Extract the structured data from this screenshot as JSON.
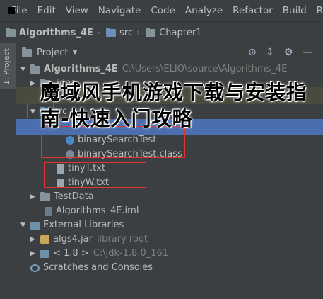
{
  "menu": {
    "items": [
      "File",
      "Edit",
      "View",
      "Navigate",
      "Code",
      "Analyze",
      "Refactor",
      "Build",
      "Run"
    ]
  },
  "breadcrumb": {
    "items": [
      "Algorithms_4E",
      "src",
      "Chapter1"
    ]
  },
  "tool_strip": {
    "project_label": "1: Project"
  },
  "project_panel": {
    "title": "Project",
    "icons": [
      "crosshair-icon",
      "collapse-icon",
      "gear-icon",
      "hide-icon"
    ]
  },
  "tree": {
    "root_name": "Algorithms_4E",
    "root_path": "C:\\Users\\ELIO\\source\\Algorithms_4E",
    "idea": ".idea",
    "src": "src",
    "binary_search_test": "binarySearchTest",
    "binary_search_test_class": "binarySearchTest.class",
    "tinyT": "tinyT.txt",
    "tinyW": "tinyW.txt",
    "test_data": "TestData",
    "iml": "Algorithms_4E.iml",
    "external_libraries": "External Libraries",
    "algs4_jar": "algs4.jar",
    "algs4_jar_note": "library root",
    "jdk": "< 1.8 >",
    "jdk_path": "C:\\jdk-1.8.0_161",
    "scratches": "Scratches and Consoles"
  },
  "watermark": {
    "text": "魔域风手机游戏下载与安装指南-快速入门攻略"
  },
  "colors": {
    "background": "#3c3f41",
    "selection": "#4b6eaf",
    "annotation_red": "#e0342c"
  }
}
